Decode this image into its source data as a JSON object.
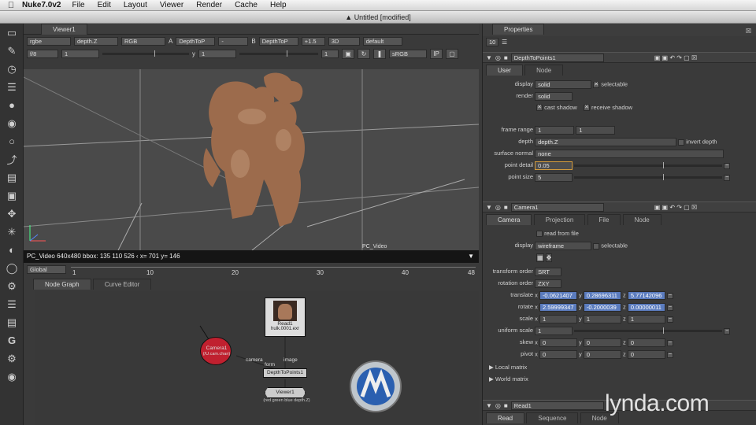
{
  "menubar": {
    "app": "Nuke7.0v2",
    "items": [
      "File",
      "Edit",
      "Layout",
      "Viewer",
      "Render",
      "Cache",
      "Help"
    ]
  },
  "window_title": "Untitled [modified]",
  "viewer": {
    "tab": "Viewer1",
    "row1": {
      "channels": "rgbe",
      "layer": "depth.Z",
      "rgb": "RGB",
      "a_label": "A",
      "a_input": "DepthToP",
      "a_op": "-",
      "b_label": "B",
      "b_input": "DepthToP",
      "gain": "+1.5",
      "view": "3D",
      "mode": "default"
    },
    "row2": {
      "fstop": "f/8",
      "frame": "1",
      "y_label": "y",
      "y_value": "1",
      "proxy": "1",
      "lut": "sRGB",
      "ip": "IP"
    },
    "bg_label": "PC_Video",
    "status": "PC_Video 640x480  bbox: 135 110 526 ‹  x= 701 y= 146",
    "transport": {
      "frame": "1",
      "inc": "10",
      "fps_label": "fps",
      "fps": "24"
    },
    "timeline": {
      "range": "Global",
      "ticks": [
        "1",
        "10",
        "20",
        "30",
        "40",
        "48"
      ]
    }
  },
  "nodegraph": {
    "tabs": [
      "Node Graph",
      "Curve Editor"
    ],
    "nodes": {
      "camera": {
        "name": "Camera1",
        "file": "(/U.cam.chan)"
      },
      "read": {
        "name": "Read1",
        "file": "hulk.0001.exr"
      },
      "depth": {
        "name": "DepthToPoints1"
      },
      "viewer": {
        "name": "Viewer1",
        "channels": "(red green blue depth.Z)"
      }
    },
    "pipes": {
      "camera": "camera",
      "image": "image",
      "form": "form"
    }
  },
  "properties": {
    "title": "Properties",
    "count": "10",
    "depthtopoints": {
      "name": "DepthToPoints1",
      "tabs": [
        "User",
        "Node"
      ],
      "display_label": "display",
      "display": "solid",
      "selectable": "selectable",
      "render_label": "render",
      "render": "solid",
      "cast_shadow": "cast shadow",
      "receive_shadow": "receive shadow",
      "frame_range_label": "frame range",
      "frame_range_a": "1",
      "frame_range_b": "1",
      "depth_label": "depth",
      "depth": "depth.Z",
      "invert_depth": "invert depth",
      "surface_normal_label": "surface normal",
      "surface_normal": "none",
      "point_detail_label": "point detail",
      "point_detail": "0.05",
      "point_size_label": "point size",
      "point_size": "5"
    },
    "camera": {
      "name": "Camera1",
      "tabs": [
        "Camera",
        "Projection",
        "File",
        "Node"
      ],
      "read_from_file": "read from file",
      "display_label": "display",
      "display": "wireframe",
      "selectable": "selectable",
      "transform_order_label": "transform order",
      "transform_order": "SRT",
      "rotation_order_label": "rotation order",
      "rotation_order": "ZXY",
      "translate_label": "translate",
      "translate": [
        "-0.0621407",
        "0.28696311",
        "5.77142096"
      ],
      "rotate_label": "rotate",
      "rotate": [
        "2.59999347",
        "-0.2000039",
        "0.00000011"
      ],
      "scale_label": "scale",
      "scale": [
        "1",
        "1",
        "1"
      ],
      "uniform_scale_label": "uniform scale",
      "uniform_scale": "1",
      "skew_label": "skew",
      "skew": [
        "0",
        "0",
        "0"
      ],
      "pivot_label": "pivot",
      "pivot": [
        "0",
        "0",
        "0"
      ],
      "local_matrix": "Local matrix",
      "world_matrix": "World matrix",
      "x": "x",
      "y": "y",
      "z": "z"
    },
    "read": {
      "name": "Read1",
      "tabs": [
        "Read",
        "Sequence",
        "Node"
      ]
    }
  },
  "watermark": "lynda.com"
}
